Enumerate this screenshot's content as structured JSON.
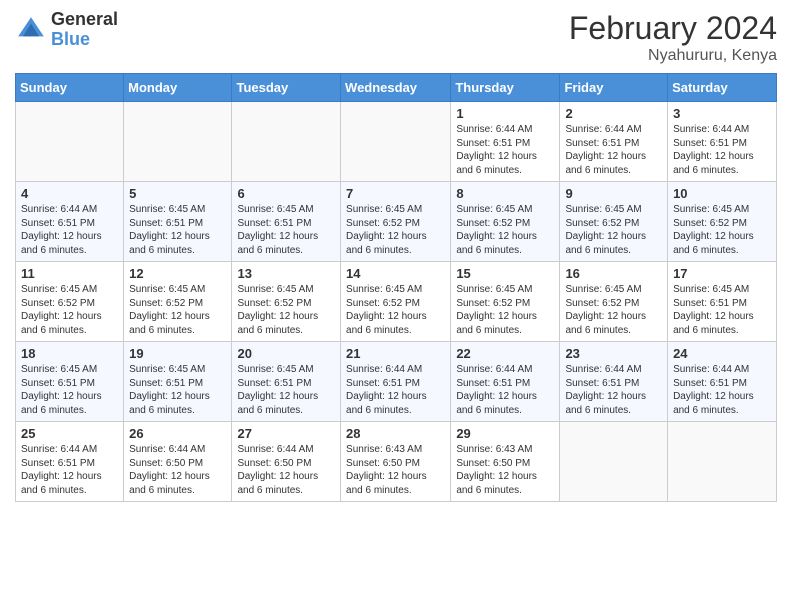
{
  "logo": {
    "general": "General",
    "blue": "Blue"
  },
  "title": {
    "month": "February 2024",
    "location": "Nyahururu, Kenya"
  },
  "weekdays": [
    "Sunday",
    "Monday",
    "Tuesday",
    "Wednesday",
    "Thursday",
    "Friday",
    "Saturday"
  ],
  "weeks": [
    [
      {
        "day": "",
        "info": ""
      },
      {
        "day": "",
        "info": ""
      },
      {
        "day": "",
        "info": ""
      },
      {
        "day": "",
        "info": ""
      },
      {
        "day": "1",
        "info": "Sunrise: 6:44 AM\nSunset: 6:51 PM\nDaylight: 12 hours and 6 minutes."
      },
      {
        "day": "2",
        "info": "Sunrise: 6:44 AM\nSunset: 6:51 PM\nDaylight: 12 hours and 6 minutes."
      },
      {
        "day": "3",
        "info": "Sunrise: 6:44 AM\nSunset: 6:51 PM\nDaylight: 12 hours and 6 minutes."
      }
    ],
    [
      {
        "day": "4",
        "info": "Sunrise: 6:44 AM\nSunset: 6:51 PM\nDaylight: 12 hours and 6 minutes."
      },
      {
        "day": "5",
        "info": "Sunrise: 6:45 AM\nSunset: 6:51 PM\nDaylight: 12 hours and 6 minutes."
      },
      {
        "day": "6",
        "info": "Sunrise: 6:45 AM\nSunset: 6:51 PM\nDaylight: 12 hours and 6 minutes."
      },
      {
        "day": "7",
        "info": "Sunrise: 6:45 AM\nSunset: 6:52 PM\nDaylight: 12 hours and 6 minutes."
      },
      {
        "day": "8",
        "info": "Sunrise: 6:45 AM\nSunset: 6:52 PM\nDaylight: 12 hours and 6 minutes."
      },
      {
        "day": "9",
        "info": "Sunrise: 6:45 AM\nSunset: 6:52 PM\nDaylight: 12 hours and 6 minutes."
      },
      {
        "day": "10",
        "info": "Sunrise: 6:45 AM\nSunset: 6:52 PM\nDaylight: 12 hours and 6 minutes."
      }
    ],
    [
      {
        "day": "11",
        "info": "Sunrise: 6:45 AM\nSunset: 6:52 PM\nDaylight: 12 hours and 6 minutes."
      },
      {
        "day": "12",
        "info": "Sunrise: 6:45 AM\nSunset: 6:52 PM\nDaylight: 12 hours and 6 minutes."
      },
      {
        "day": "13",
        "info": "Sunrise: 6:45 AM\nSunset: 6:52 PM\nDaylight: 12 hours and 6 minutes."
      },
      {
        "day": "14",
        "info": "Sunrise: 6:45 AM\nSunset: 6:52 PM\nDaylight: 12 hours and 6 minutes."
      },
      {
        "day": "15",
        "info": "Sunrise: 6:45 AM\nSunset: 6:52 PM\nDaylight: 12 hours and 6 minutes."
      },
      {
        "day": "16",
        "info": "Sunrise: 6:45 AM\nSunset: 6:52 PM\nDaylight: 12 hours and 6 minutes."
      },
      {
        "day": "17",
        "info": "Sunrise: 6:45 AM\nSunset: 6:51 PM\nDaylight: 12 hours and 6 minutes."
      }
    ],
    [
      {
        "day": "18",
        "info": "Sunrise: 6:45 AM\nSunset: 6:51 PM\nDaylight: 12 hours and 6 minutes."
      },
      {
        "day": "19",
        "info": "Sunrise: 6:45 AM\nSunset: 6:51 PM\nDaylight: 12 hours and 6 minutes."
      },
      {
        "day": "20",
        "info": "Sunrise: 6:45 AM\nSunset: 6:51 PM\nDaylight: 12 hours and 6 minutes."
      },
      {
        "day": "21",
        "info": "Sunrise: 6:44 AM\nSunset: 6:51 PM\nDaylight: 12 hours and 6 minutes."
      },
      {
        "day": "22",
        "info": "Sunrise: 6:44 AM\nSunset: 6:51 PM\nDaylight: 12 hours and 6 minutes."
      },
      {
        "day": "23",
        "info": "Sunrise: 6:44 AM\nSunset: 6:51 PM\nDaylight: 12 hours and 6 minutes."
      },
      {
        "day": "24",
        "info": "Sunrise: 6:44 AM\nSunset: 6:51 PM\nDaylight: 12 hours and 6 minutes."
      }
    ],
    [
      {
        "day": "25",
        "info": "Sunrise: 6:44 AM\nSunset: 6:51 PM\nDaylight: 12 hours and 6 minutes."
      },
      {
        "day": "26",
        "info": "Sunrise: 6:44 AM\nSunset: 6:50 PM\nDaylight: 12 hours and 6 minutes."
      },
      {
        "day": "27",
        "info": "Sunrise: 6:44 AM\nSunset: 6:50 PM\nDaylight: 12 hours and 6 minutes."
      },
      {
        "day": "28",
        "info": "Sunrise: 6:43 AM\nSunset: 6:50 PM\nDaylight: 12 hours and 6 minutes."
      },
      {
        "day": "29",
        "info": "Sunrise: 6:43 AM\nSunset: 6:50 PM\nDaylight: 12 hours and 6 minutes."
      },
      {
        "day": "",
        "info": ""
      },
      {
        "day": "",
        "info": ""
      }
    ]
  ]
}
